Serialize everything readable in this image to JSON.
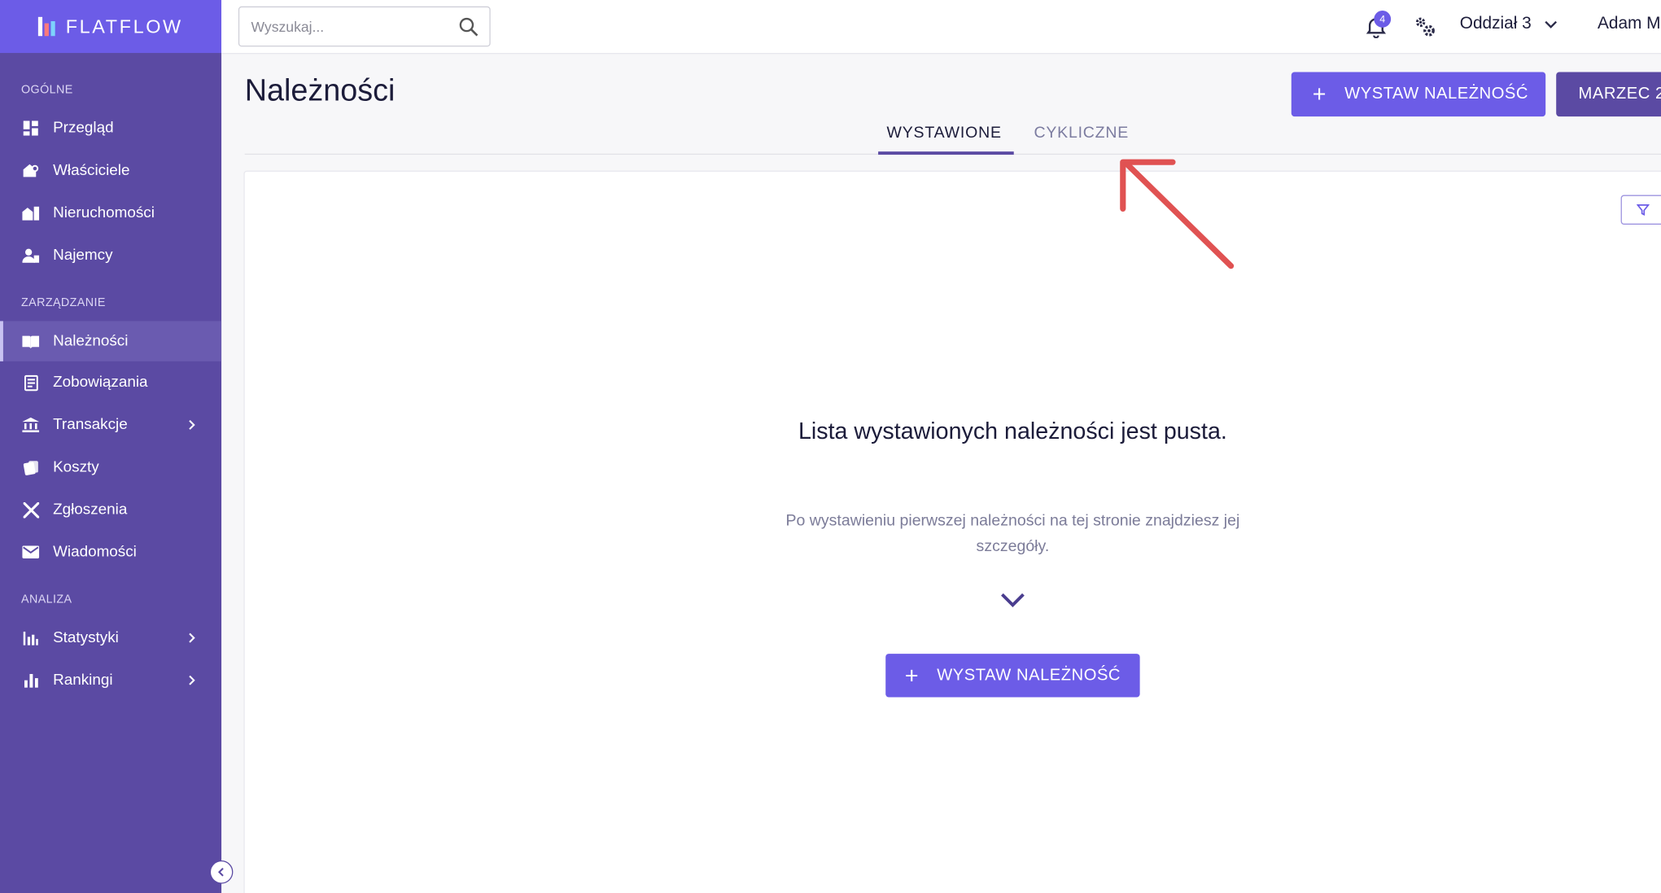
{
  "app": {
    "name": "FLATFLOW"
  },
  "search": {
    "placeholder": "Wyszukaj..."
  },
  "topbar": {
    "notification_count": "4",
    "branch": "Oddział 3",
    "user": "Adam M"
  },
  "sidebar": {
    "sections": [
      {
        "label": "OGÓLNE",
        "items": [
          {
            "label": "Przegląd",
            "icon": "dashboard-icon"
          },
          {
            "label": "Właściciele",
            "icon": "owners-icon"
          },
          {
            "label": "Nieruchomości",
            "icon": "buildings-icon"
          },
          {
            "label": "Najemcy",
            "icon": "tenants-icon"
          }
        ]
      },
      {
        "label": "ZARZĄDZANIE",
        "items": [
          {
            "label": "Należności",
            "icon": "receivables-icon",
            "active": true
          },
          {
            "label": "Zobowiązania",
            "icon": "liabilities-icon"
          },
          {
            "label": "Transakcje",
            "icon": "bank-icon",
            "has_submenu": true
          },
          {
            "label": "Koszty",
            "icon": "costs-icon"
          },
          {
            "label": "Zgłoszenia",
            "icon": "tools-icon"
          },
          {
            "label": "Wiadomości",
            "icon": "mail-icon"
          }
        ]
      },
      {
        "label": "ANALIZA",
        "items": [
          {
            "label": "Statystyki",
            "icon": "stats-icon",
            "has_submenu": true
          },
          {
            "label": "Rankingi",
            "icon": "ranking-icon",
            "has_submenu": true
          }
        ]
      }
    ]
  },
  "page": {
    "title": "Należności",
    "primary_action": "WYSTAW NALEŻNOŚĆ",
    "period_button": "MARZEC 2",
    "tabs": [
      {
        "label": "WYSTAWIONE",
        "active": true
      },
      {
        "label": "CYKLICZNE",
        "active": false
      }
    ]
  },
  "empty_state": {
    "title": "Lista wystawionych należności jest pusta.",
    "description": "Po wystawieniu pierwszej należności na tej stronie znajdziesz jej szczegóły.",
    "cta": "WYSTAW NALEŻNOŚĆ"
  },
  "colors": {
    "sidebar": "#5b4aa3",
    "accent": "#6c5ce7",
    "annotation_arrow": "#e05252"
  }
}
